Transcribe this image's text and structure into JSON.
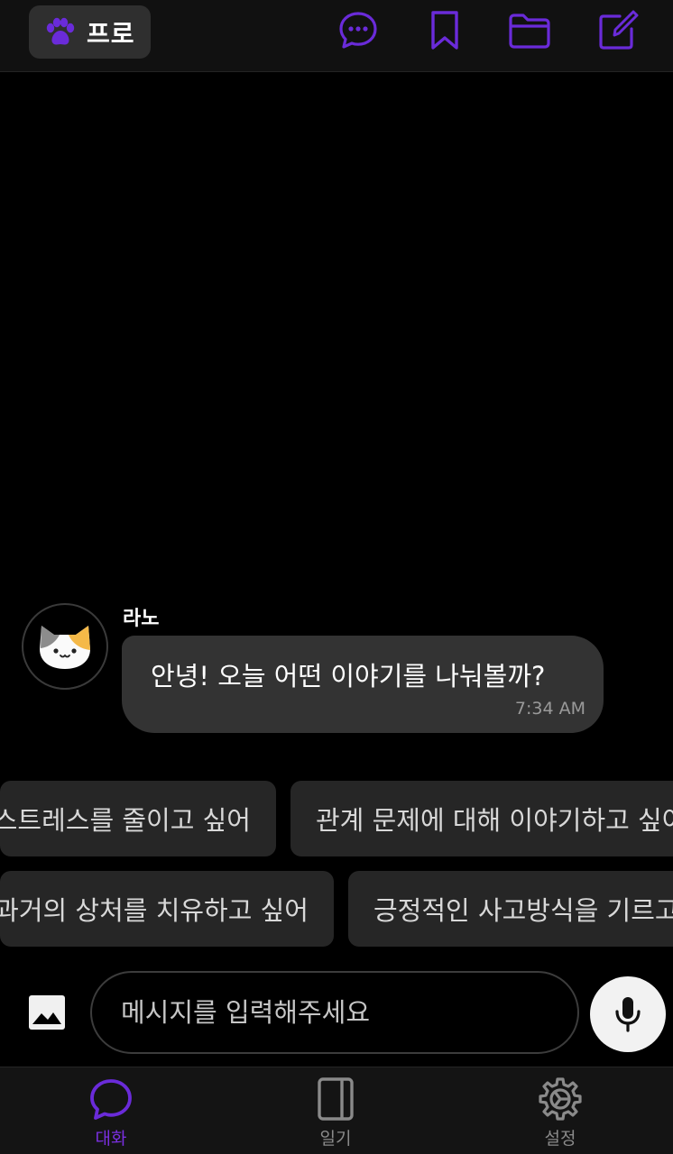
{
  "header": {
    "badge_label": "프로",
    "badge_icon": "paw-icon",
    "icons": [
      "chat-bubble-icon",
      "bookmark-icon",
      "folder-icon",
      "edit-icon"
    ],
    "accent_color": "#6a2bd9"
  },
  "message": {
    "sender": "라노",
    "text": "안녕! 오늘 어떤 이야기를 나눠볼까?",
    "time": "7:34 AM",
    "avatar_icon": "cat-avatar-icon"
  },
  "suggestions": {
    "row1": [
      "스트레스를 줄이고 싶어",
      "관계 문제에 대해 이야기하고 싶어"
    ],
    "row2": [
      "과거의 상처를 치유하고 싶어",
      "긍정적인 사고방식을 기르고"
    ]
  },
  "input": {
    "placeholder": "메시지를 입력해주세요",
    "image_icon": "image-icon",
    "mic_icon": "microphone-icon"
  },
  "nav": {
    "items": [
      {
        "label": "대화",
        "icon": "chat-icon",
        "active": true
      },
      {
        "label": "일기",
        "icon": "diary-icon",
        "active": false
      },
      {
        "label": "설정",
        "icon": "settings-gear-icon",
        "active": false
      }
    ],
    "active_color": "#7a2fe0",
    "inactive_color": "#8a8a8a"
  }
}
